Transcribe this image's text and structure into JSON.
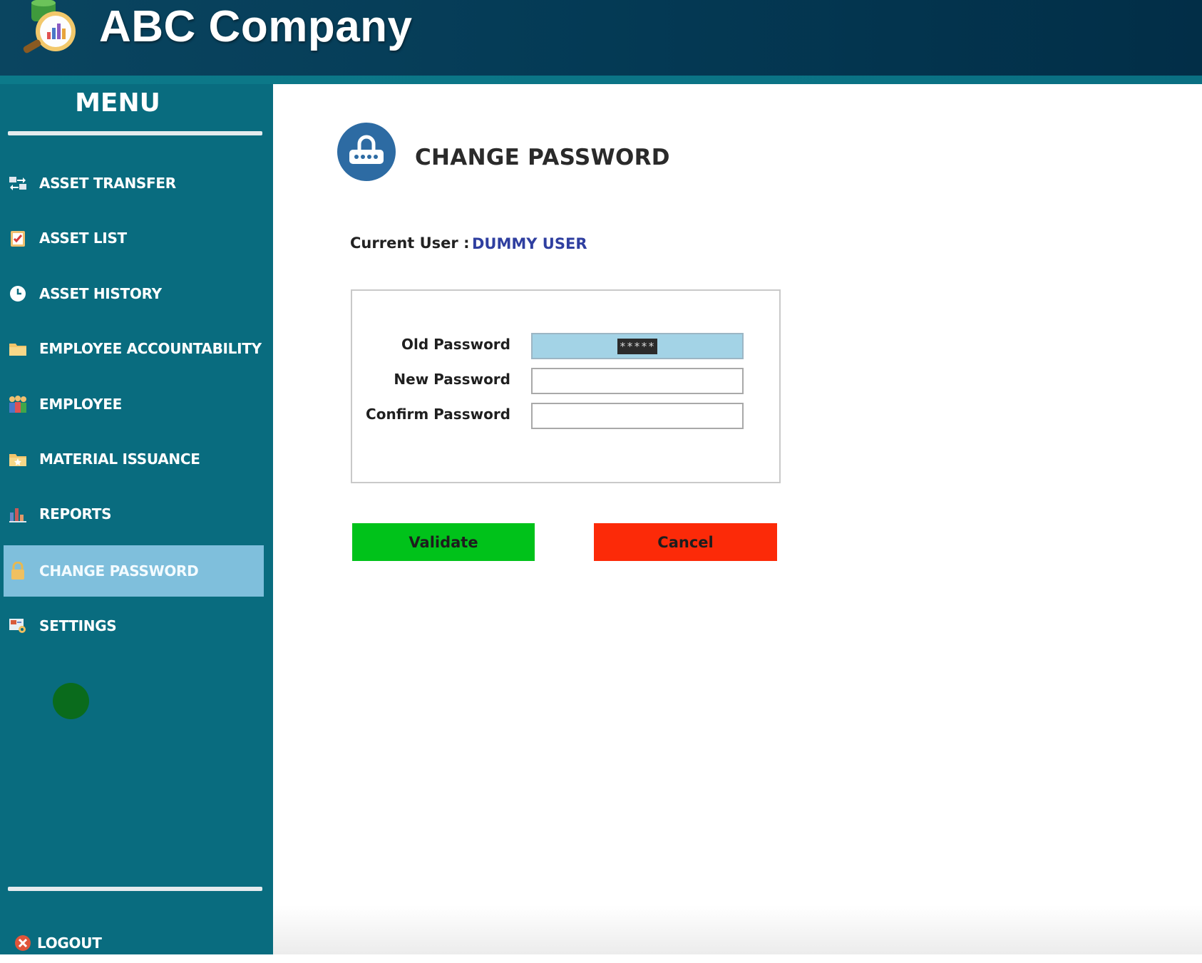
{
  "app": {
    "title": "ABC Company"
  },
  "sidebar": {
    "menu_title": "MENU",
    "items": [
      {
        "label": "ASSET TRANSFER",
        "icon": "transfer-icon"
      },
      {
        "label": "ASSET LIST",
        "icon": "clipboard-check-icon"
      },
      {
        "label": "ASSET HISTORY",
        "icon": "clock-icon"
      },
      {
        "label": "EMPLOYEE ACCOUNTABILITY",
        "icon": "folder-icon"
      },
      {
        "label": "EMPLOYEE",
        "icon": "people-icon"
      },
      {
        "label": "MATERIAL ISSUANCE",
        "icon": "folder-star-icon"
      },
      {
        "label": "REPORTS",
        "icon": "bar-chart-icon"
      },
      {
        "label": "CHANGE PASSWORD",
        "icon": "lock-icon",
        "active": true
      },
      {
        "label": "SETTINGS",
        "icon": "settings-icon"
      }
    ],
    "logout_label": "LOGOUT"
  },
  "main": {
    "page_title": "CHANGE PASSWORD",
    "current_user_label": "Current User :",
    "current_user_value": "DUMMY USER",
    "fields": {
      "old_password": {
        "label": "Old Password",
        "value": "*****"
      },
      "new_password": {
        "label": "New Password",
        "value": ""
      },
      "confirm_password": {
        "label": "Confirm Password",
        "value": ""
      }
    },
    "validate_label": "Validate",
    "cancel_label": "Cancel"
  },
  "colors": {
    "header": "#043a55",
    "sidebar": "#096c7f",
    "active_item": "#7fbfdc",
    "validate": "#00c21a",
    "cancel": "#fc2a08",
    "user_value": "#2f3fa0"
  }
}
